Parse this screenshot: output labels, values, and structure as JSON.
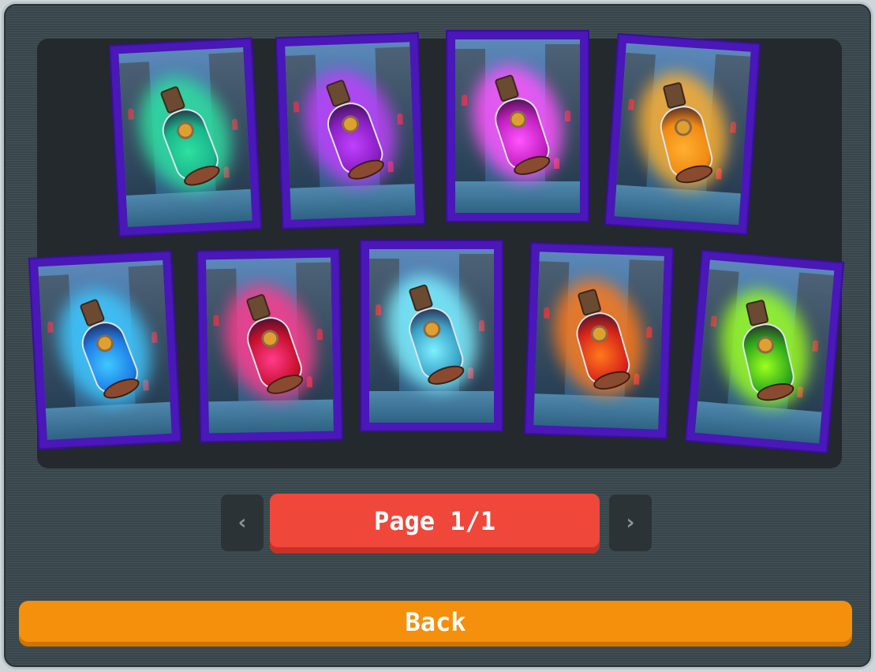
{
  "potions": [
    {
      "name": "teal-potion-card",
      "color": "#19b68c",
      "glow": "#2fe0a0"
    },
    {
      "name": "purple-potion-card",
      "color": "#8a1fc4",
      "glow": "#c040ff"
    },
    {
      "name": "magenta-potion-card",
      "color": "#c21fbf",
      "glow": "#ff55ff"
    },
    {
      "name": "orange-potion-card",
      "color": "#f08a12",
      "glow": "#ffb030"
    },
    {
      "name": "blue-potion-card",
      "color": "#1e7ee8",
      "glow": "#40c8ff"
    },
    {
      "name": "crimson-potion-card",
      "color": "#c8102e",
      "glow": "#ff3c8c"
    },
    {
      "name": "cyan-potion-card",
      "color": "#3aa3c8",
      "glow": "#7ef0ff"
    },
    {
      "name": "red-potion-card",
      "color": "#d8241a",
      "glow": "#ff7a1a"
    },
    {
      "name": "green-potion-card",
      "color": "#2ea81a",
      "glow": "#9cff20"
    }
  ],
  "pagination": {
    "prev_icon": "‹",
    "next_icon": "›",
    "page_label": "Page 1/1"
  },
  "back_label": "Back"
}
